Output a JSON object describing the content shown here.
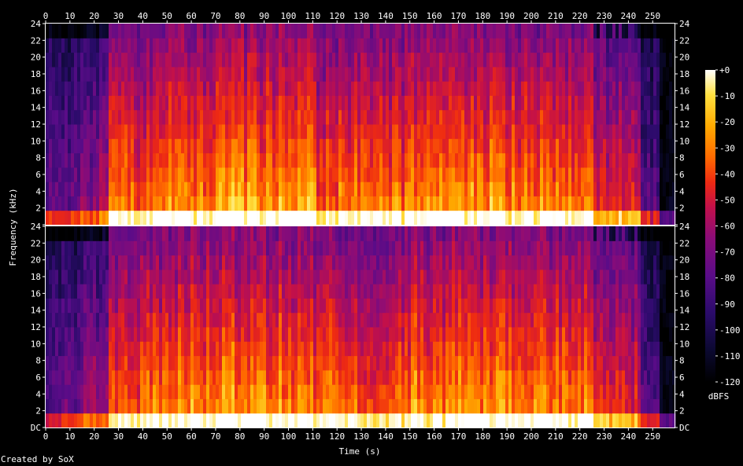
{
  "chart_data": {
    "type": "heatmap",
    "kind": "spectrogram",
    "xlabel": "Time (s)",
    "ylabel": "Frequency (kHz)",
    "x_ticks": [
      0,
      10,
      20,
      30,
      40,
      50,
      60,
      70,
      80,
      90,
      100,
      110,
      120,
      130,
      140,
      150,
      160,
      170,
      180,
      190,
      200,
      210,
      220,
      230,
      240,
      250
    ],
    "xlim": [
      0,
      259
    ],
    "y_ticks": [
      "DC",
      "2",
      "4",
      "6",
      "8",
      "10",
      "12",
      "14",
      "16",
      "18",
      "20",
      "22",
      "24"
    ],
    "y_tick_values": [
      0,
      2,
      4,
      6,
      8,
      10,
      12,
      14,
      16,
      18,
      20,
      22,
      24
    ],
    "ylim": [
      0,
      24
    ],
    "channels": 2,
    "colorbar": {
      "label": "dBFS",
      "ticks": [
        "+0",
        "-10",
        "-20",
        "-30",
        "-40",
        "-50",
        "-60",
        "-70",
        "-80",
        "-90",
        "-100",
        "-110",
        "-120"
      ],
      "range": [
        -120,
        0
      ]
    },
    "colormap": [
      "#000000",
      "#0b0930",
      "#2a0b6a",
      "#5a0c88",
      "#8a0c78",
      "#c2104a",
      "#ee2a12",
      "#ff6a00",
      "#ffaa00",
      "#ffe040",
      "#ffffff"
    ],
    "loud_segments": [
      {
        "start": 0,
        "end": 14,
        "level": 0.35
      },
      {
        "start": 14,
        "end": 25,
        "level": 0.45
      },
      {
        "start": 25,
        "end": 50,
        "level": 0.72
      },
      {
        "start": 50,
        "end": 76,
        "level": 0.8
      },
      {
        "start": 76,
        "end": 110,
        "level": 0.82
      },
      {
        "start": 110,
        "end": 150,
        "level": 0.74
      },
      {
        "start": 150,
        "end": 190,
        "level": 0.8
      },
      {
        "start": 190,
        "end": 225,
        "level": 0.78
      },
      {
        "start": 225,
        "end": 245,
        "level": 0.6
      },
      {
        "start": 245,
        "end": 252,
        "level": 0.3
      },
      {
        "start": 252,
        "end": 259,
        "level": 0.05
      }
    ]
  },
  "footer": {
    "text": "Created by SoX"
  }
}
